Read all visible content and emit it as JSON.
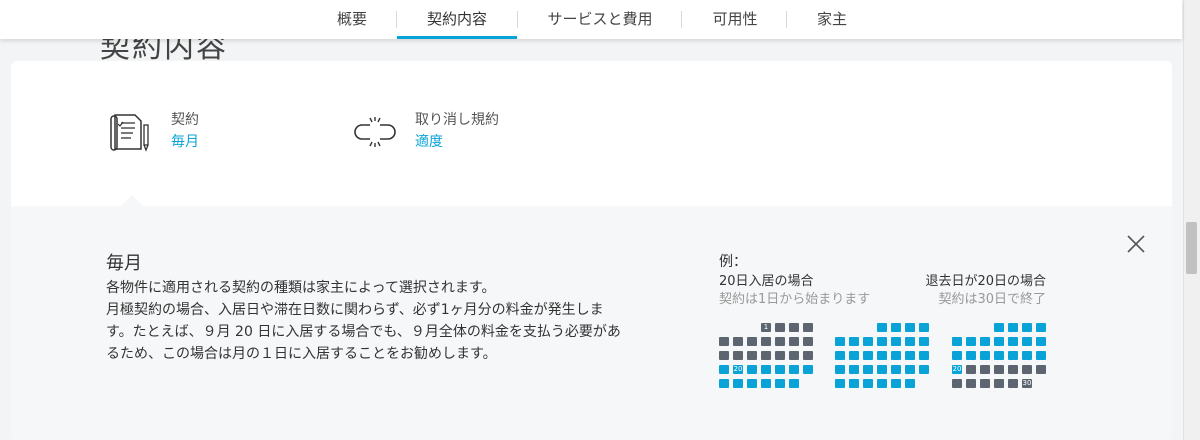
{
  "nav": {
    "tabs": [
      {
        "label": "概要",
        "active": false
      },
      {
        "label": "契約内容",
        "active": true
      },
      {
        "label": "サービスと費用",
        "active": false
      },
      {
        "label": "可用性",
        "active": false
      },
      {
        "label": "家主",
        "active": false
      }
    ]
  },
  "ghost_title": "契約内容",
  "summary": {
    "contract": {
      "label": "契約",
      "value": "毎月",
      "icon": "contract-document-icon"
    },
    "cancellation": {
      "label": "取り消し規約",
      "value": "適度",
      "icon": "broken-link-icon"
    }
  },
  "detail": {
    "title": "毎月",
    "paragraph": [
      "各物件に適用される契約の種類は家主によって選択されます。",
      "月極契約の場合、入居日や滞在日数に関わらず、必ず1ヶ月分の料金が発生しま",
      "す。たとえば、９月 20 日に入居する場合でも、９月全体の料金を支払う必要があ",
      "るため、この場合は月の１日に入居することをお勧めします。"
    ],
    "close_icon": "close-icon"
  },
  "example": {
    "title": "例：",
    "left_line1": "20日入居の場合",
    "left_line2": "契約は1日から始まります",
    "right_line1": "退去日が20日の場合",
    "right_line2": "契約は30日で終了",
    "calendars": [
      {
        "rows": [
          [
            "",
            "",
            "",
            "g:1",
            "g",
            "g",
            "g"
          ],
          [
            "g",
            "g",
            "g",
            "g",
            "g",
            "g",
            "g"
          ],
          [
            "g",
            "g",
            "g",
            "g",
            "g",
            "g",
            "g"
          ],
          [
            "b",
            "b:20",
            "b",
            "b",
            "b",
            "b",
            "b"
          ],
          [
            "b",
            "b",
            "b",
            "b",
            "b",
            "b",
            ""
          ]
        ]
      },
      {
        "rows": [
          [
            "",
            "",
            "",
            "b",
            "b",
            "b",
            "b"
          ],
          [
            "b",
            "b",
            "b",
            "b",
            "b",
            "b",
            "b"
          ],
          [
            "b",
            "b",
            "b",
            "b",
            "b",
            "b",
            "b"
          ],
          [
            "b",
            "b",
            "b",
            "b",
            "b",
            "b",
            "b"
          ],
          [
            "b",
            "b",
            "b",
            "b",
            "b",
            "b",
            ""
          ]
        ]
      },
      {
        "rows": [
          [
            "",
            "",
            "",
            "b",
            "b",
            "b",
            "b"
          ],
          [
            "b",
            "b",
            "b",
            "b",
            "b",
            "b",
            "b"
          ],
          [
            "b",
            "b",
            "b",
            "b",
            "b",
            "b",
            "b"
          ],
          [
            "b:20",
            "g",
            "g",
            "g",
            "g",
            "g",
            "g"
          ],
          [
            "g",
            "g",
            "g",
            "g",
            "g",
            "g:30",
            ""
          ]
        ]
      }
    ]
  },
  "colors": {
    "accent": "#0aa3d8",
    "cell_gray": "#5c6570"
  }
}
